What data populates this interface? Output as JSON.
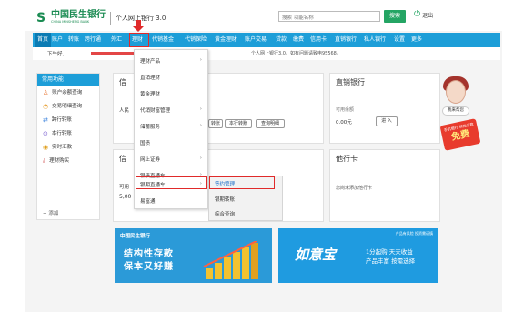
{
  "header": {
    "logo_mark": "S",
    "logo_cn": "中国民生银行",
    "logo_en": "CHINA MINSHENG BANK",
    "subtitle": "个人网上银行 3.0",
    "search_placeholder": "搜索 功能名称",
    "search_button": "搜索",
    "exit_label": "退出",
    "exit_icon": "power-icon"
  },
  "nav": {
    "items": [
      "首页",
      "账户",
      "转账",
      "跨行通",
      "外汇",
      "理财",
      "代销基金",
      "代销保险",
      "黄金理财",
      "账户交易",
      "贷款",
      "缴费",
      "信用卡",
      "直销银行",
      "私人银行",
      "设置",
      "更多"
    ],
    "active": "首页",
    "highlighted": "理财"
  },
  "welcome": {
    "greeting": "下午好,",
    "notice": "个人网上银行3.0。如有问题请致电95568。"
  },
  "sidebar": {
    "title": "常用功能",
    "items": [
      {
        "label": "账户余额查询",
        "icon": "person-icon"
      },
      {
        "label": "交易明细查询",
        "icon": "search-list-icon"
      },
      {
        "label": "跨行转账",
        "icon": "transfer-icon"
      },
      {
        "label": "本行转账",
        "icon": "bank-transfer-icon"
      },
      {
        "label": "实时汇款",
        "icon": "coin-icon"
      },
      {
        "label": "理财购买",
        "icon": "chart-icon"
      }
    ],
    "add_label": "+  添加"
  },
  "card_account": {
    "title": "信",
    "label": "人民",
    "buttons": [
      "转账",
      "本行转账",
      "查询明细"
    ]
  },
  "card_credit": {
    "title": "信",
    "label": "可用",
    "amount": "5,00"
  },
  "card_direct": {
    "title": "直销银行",
    "balance_label": "可用余额",
    "balance": "0.00元",
    "enter_button": "进 入"
  },
  "card_other": {
    "title": "他行卡",
    "message": "您尚未添加他行卡"
  },
  "menu_level1": {
    "items": [
      {
        "label": "理财产品",
        "has_sub": true
      },
      {
        "label": "直销理财",
        "has_sub": false
      },
      {
        "label": "黄金理财",
        "has_sub": false
      },
      {
        "label": "代销财富管理",
        "has_sub": true
      },
      {
        "label": "储蓄服务",
        "has_sub": true
      },
      {
        "label": "国债",
        "has_sub": false
      },
      {
        "label": "网上证券",
        "has_sub": true
      },
      {
        "label": "银债直通车",
        "has_sub": true
      },
      {
        "label": "银期直通车",
        "has_sub": true
      },
      {
        "label": "易富通",
        "has_sub": false
      }
    ],
    "selected": "银期直通车"
  },
  "menu_level2": {
    "items": [
      "签约管理",
      "银期转账",
      "综合查询"
    ],
    "selected": "签约管理"
  },
  "banner_left": {
    "brand": "中国民生银行",
    "line1": "结构性存款",
    "line2": "保本又好赚"
  },
  "banner_right": {
    "title": "如意宝",
    "tag": "产品有风险 投资需谨慎",
    "line1": "1分起购 天天收益",
    "line2": "产品丰富 按需选择"
  },
  "assistant": {
    "tag": "我来帮您",
    "promo_small": "手机银行 转账汇款",
    "promo_big": "免费"
  },
  "colors": {
    "brand_green": "#1a8b52",
    "nav_blue": "#1d9ed8",
    "highlight_red": "#e02a2a",
    "banner_blue": "#1f9be0"
  }
}
